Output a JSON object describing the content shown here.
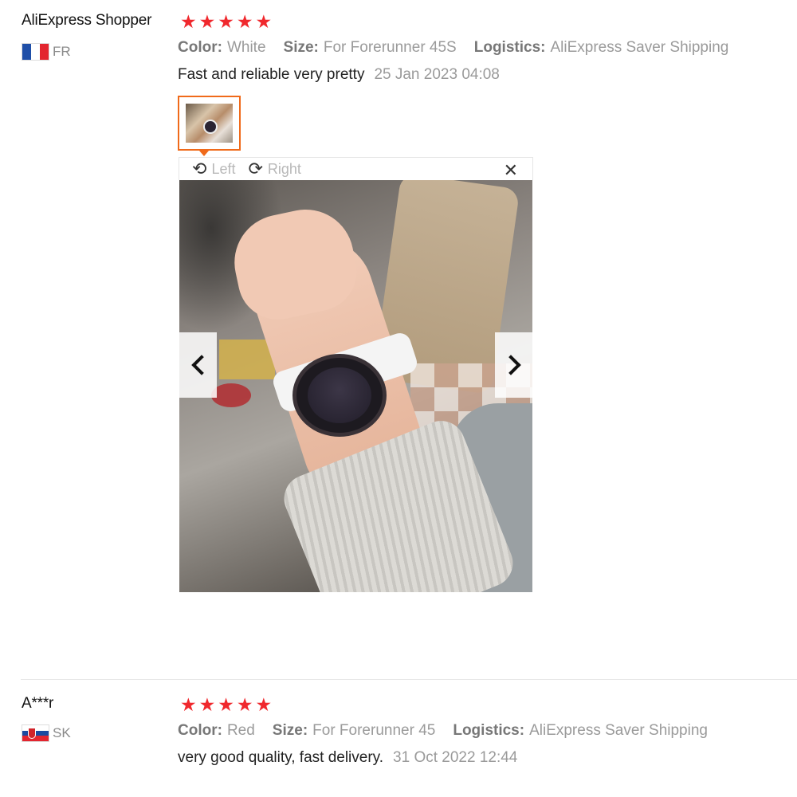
{
  "reviews": [
    {
      "user": "AliExpress Shopper",
      "country": "FR",
      "flag": "france-flag",
      "rating": 5,
      "stars": [
        "★",
        "★",
        "★",
        "★",
        "★"
      ],
      "color_key": "Color:",
      "color": "White",
      "size_key": "Size:",
      "size": "For Forerunner 45S",
      "logistics_key": "Logistics:",
      "logistics": "AliExpress Saver Shipping",
      "text": "Fast and reliable very pretty",
      "date": "25 Jan 2023 04:08",
      "viewer": {
        "rotate_left_icon": "⟲",
        "rotate_left": "Left",
        "rotate_right_icon": "⟳",
        "rotate_right": "Right",
        "close_icon": "✕"
      }
    },
    {
      "user": "A***r",
      "country": "SK",
      "flag": "slovakia-flag",
      "rating": 5,
      "stars": [
        "★",
        "★",
        "★",
        "★",
        "★"
      ],
      "color_key": "Color:",
      "color": "Red",
      "size_key": "Size:",
      "size": "For Forerunner 45",
      "logistics_key": "Logistics:",
      "logistics": "AliExpress Saver Shipping",
      "text": "very good quality, fast delivery.",
      "date": "31 Oct 2022 12:44"
    }
  ],
  "colors": {
    "star": "#f0282d",
    "accent": "#f06a1a",
    "muted": "#9a9a9a"
  }
}
